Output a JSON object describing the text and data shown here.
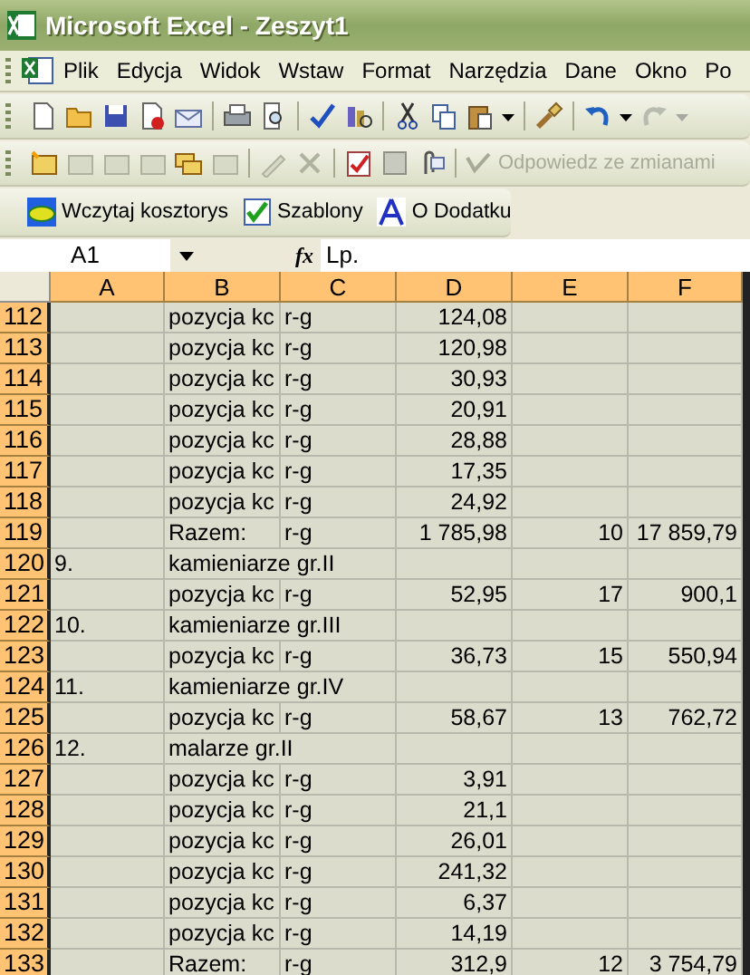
{
  "window": {
    "title": "Microsoft Excel - Zeszyt1"
  },
  "menu": [
    "Plik",
    "Edycja",
    "Widok",
    "Wstaw",
    "Format",
    "Narzędzia",
    "Dane",
    "Okno",
    "Po"
  ],
  "review_toolbar": {
    "label": "Odpowiedz ze zmianami",
    "disabled": true
  },
  "addin_toolbar": [
    "Wczytaj kosztorys",
    "Szablony",
    "O Dodatku"
  ],
  "formula_bar": {
    "name_box": "A1",
    "fx_label": "fx",
    "value": "Lp."
  },
  "columns": [
    "A",
    "B",
    "C",
    "D",
    "E",
    "F"
  ],
  "rows": [
    {
      "num": "112",
      "cells": [
        "",
        "pozycja kc",
        "r-g",
        "124,08",
        "",
        ""
      ]
    },
    {
      "num": "113",
      "cells": [
        "",
        "pozycja kc",
        "r-g",
        "120,98",
        "",
        ""
      ]
    },
    {
      "num": "114",
      "cells": [
        "",
        "pozycja kc",
        "r-g",
        "30,93",
        "",
        ""
      ]
    },
    {
      "num": "115",
      "cells": [
        "",
        "pozycja kc",
        "r-g",
        "20,91",
        "",
        ""
      ]
    },
    {
      "num": "116",
      "cells": [
        "",
        "pozycja kc",
        "r-g",
        "28,88",
        "",
        ""
      ]
    },
    {
      "num": "117",
      "cells": [
        "",
        "pozycja kc",
        "r-g",
        "17,35",
        "",
        ""
      ]
    },
    {
      "num": "118",
      "cells": [
        "",
        "pozycja kc",
        "r-g",
        "24,92",
        "",
        ""
      ]
    },
    {
      "num": "119",
      "cells": [
        "",
        "Razem:",
        "r-g",
        "1 785,98",
        "10",
        "17 859,79"
      ]
    },
    {
      "num": "120",
      "cells": [
        "9.",
        "kamieniarze gr.II",
        "",
        "",
        "",
        ""
      ]
    },
    {
      "num": "121",
      "cells": [
        "",
        "pozycja kc",
        "r-g",
        "52,95",
        "17",
        "900,1"
      ]
    },
    {
      "num": "122",
      "cells": [
        "10.",
        "kamieniarze gr.III",
        "",
        "",
        "",
        ""
      ]
    },
    {
      "num": "123",
      "cells": [
        "",
        "pozycja kc",
        "r-g",
        "36,73",
        "15",
        "550,94"
      ]
    },
    {
      "num": "124",
      "cells": [
        "11.",
        "kamieniarze gr.IV",
        "",
        "",
        "",
        ""
      ]
    },
    {
      "num": "125",
      "cells": [
        "",
        "pozycja kc",
        "r-g",
        "58,67",
        "13",
        "762,72"
      ]
    },
    {
      "num": "126",
      "cells": [
        "12.",
        "malarze gr.II",
        "",
        "",
        "",
        ""
      ]
    },
    {
      "num": "127",
      "cells": [
        "",
        "pozycja kc",
        "r-g",
        "3,91",
        "",
        ""
      ]
    },
    {
      "num": "128",
      "cells": [
        "",
        "pozycja kc",
        "r-g",
        "21,1",
        "",
        ""
      ]
    },
    {
      "num": "129",
      "cells": [
        "",
        "pozycja kc",
        "r-g",
        "26,01",
        "",
        ""
      ]
    },
    {
      "num": "130",
      "cells": [
        "",
        "pozycja kc",
        "r-g",
        "241,32",
        "",
        ""
      ]
    },
    {
      "num": "131",
      "cells": [
        "",
        "pozycja kc",
        "r-g",
        "6,37",
        "",
        ""
      ]
    },
    {
      "num": "132",
      "cells": [
        "",
        "pozycja kc",
        "r-g",
        "14,19",
        "",
        ""
      ]
    },
    {
      "num": "133",
      "cells": [
        "",
        "Razem:",
        "r-g",
        "312,9",
        "12",
        "3 754,79"
      ]
    }
  ]
}
